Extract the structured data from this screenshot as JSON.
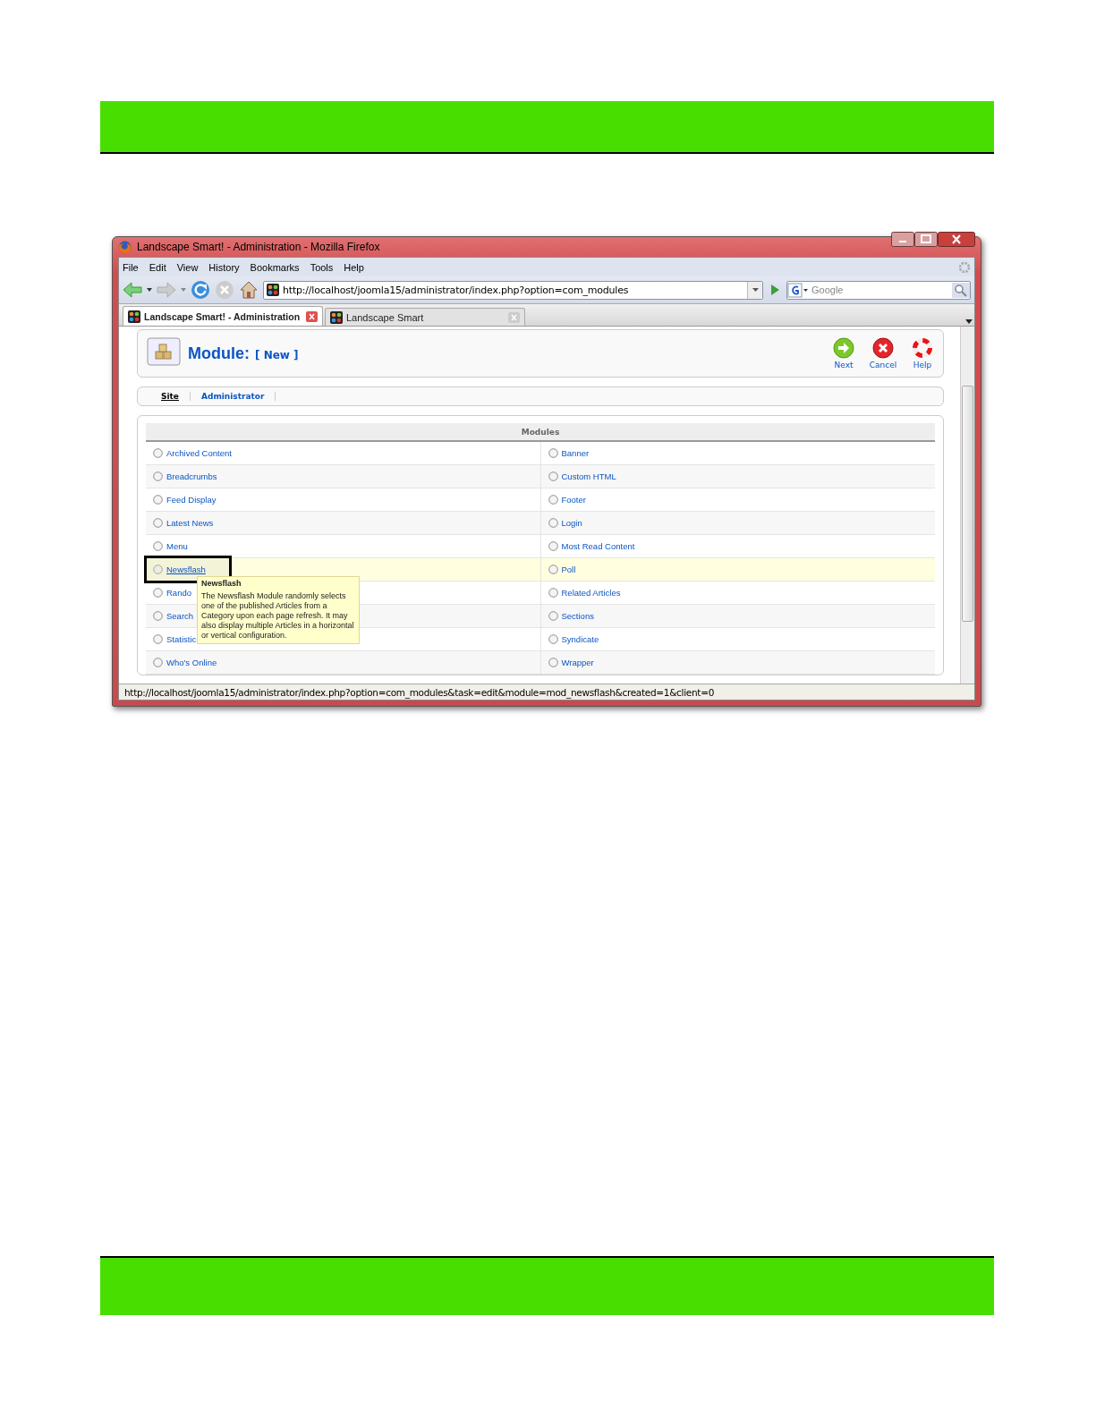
{
  "window": {
    "title": "Landscape Smart! - Administration - Mozilla Firefox"
  },
  "menu": [
    "File",
    "Edit",
    "View",
    "History",
    "Bookmarks",
    "Tools",
    "Help"
  ],
  "address_bar": {
    "value": "http://localhost/joomla15/administrator/index.php?option=com_modules"
  },
  "search": {
    "placeholder": "Google"
  },
  "tabs": [
    {
      "label": "Landscape Smart! - Administration",
      "selected": true
    },
    {
      "label": "Landscape Smart",
      "selected": false
    }
  ],
  "header": {
    "title": "Module:",
    "subtitle": "[ New ]"
  },
  "toolbar": [
    {
      "kind": "next",
      "label": "Next"
    },
    {
      "kind": "cancel",
      "label": "Cancel"
    },
    {
      "kind": "help",
      "label": "Help"
    }
  ],
  "submenu": [
    {
      "label": "Site",
      "selected": true
    },
    {
      "label": "Administrator",
      "selected": false
    }
  ],
  "table": {
    "heading": "Modules",
    "rows": [
      {
        "hovered": false,
        "cells": [
          {
            "label": "Archived Content",
            "outlined": false
          },
          {
            "label": "Banner",
            "outlined": false
          }
        ]
      },
      {
        "hovered": false,
        "cells": [
          {
            "label": "Breadcrumbs",
            "outlined": false
          },
          {
            "label": "Custom HTML",
            "outlined": false
          }
        ]
      },
      {
        "hovered": false,
        "cells": [
          {
            "label": "Feed Display",
            "outlined": false
          },
          {
            "label": "Footer",
            "outlined": false
          }
        ]
      },
      {
        "hovered": false,
        "cells": [
          {
            "label": "Latest News",
            "outlined": false
          },
          {
            "label": "Login",
            "outlined": false
          }
        ]
      },
      {
        "hovered": false,
        "cells": [
          {
            "label": "Menu",
            "outlined": false
          },
          {
            "label": "Most Read Content",
            "outlined": false
          }
        ]
      },
      {
        "hovered": true,
        "cells": [
          {
            "label": "Newsflash",
            "outlined": true
          },
          {
            "label": "Poll",
            "outlined": false
          }
        ]
      },
      {
        "hovered": false,
        "cells": [
          {
            "label": "Rando",
            "outlined": false
          },
          {
            "label": "Related Articles",
            "outlined": false
          }
        ]
      },
      {
        "hovered": false,
        "cells": [
          {
            "label": "Search",
            "outlined": false
          },
          {
            "label": "Sections",
            "outlined": false
          }
        ]
      },
      {
        "hovered": false,
        "cells": [
          {
            "label": "Statistic",
            "outlined": false
          },
          {
            "label": "Syndicate",
            "outlined": false
          }
        ]
      },
      {
        "hovered": false,
        "cells": [
          {
            "label": "Who's Online",
            "outlined": false
          },
          {
            "label": "Wrapper",
            "outlined": false
          }
        ]
      }
    ]
  },
  "tooltip": {
    "title": "Newsflash",
    "text": "The Newsflash Module randomly selects one of the published Articles from a Category upon each page refresh. It may also display multiple Articles in a horizontal or vertical configuration."
  },
  "status_bar": "http://localhost/joomla15/administrator/index.php?option=com_modules&task=edit&module=mod_newsflash&created=1&client=0"
}
